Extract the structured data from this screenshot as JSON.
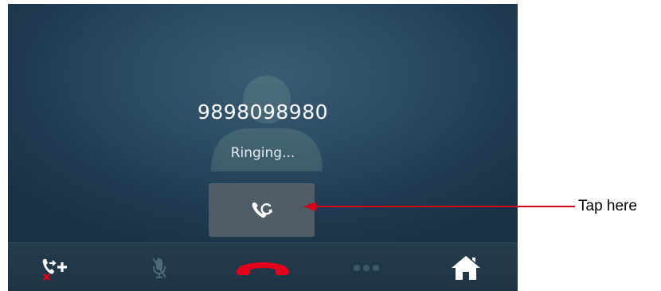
{
  "call": {
    "number": "9898098980",
    "status": "Ringing..."
  },
  "controls": {
    "swap_icon": "swap-call-icon",
    "add_call_icon": "add-call-disabled-icon",
    "mute_icon": "mute-disabled-icon",
    "end_call_icon": "end-call-icon",
    "more_icon": "more-dots-icon",
    "home_icon": "home-icon"
  },
  "annotation": {
    "label": "Tap here"
  },
  "colors": {
    "end_call": "#e3001b",
    "annotation": "#d0021b",
    "screen_bg": "#2a4a60"
  }
}
